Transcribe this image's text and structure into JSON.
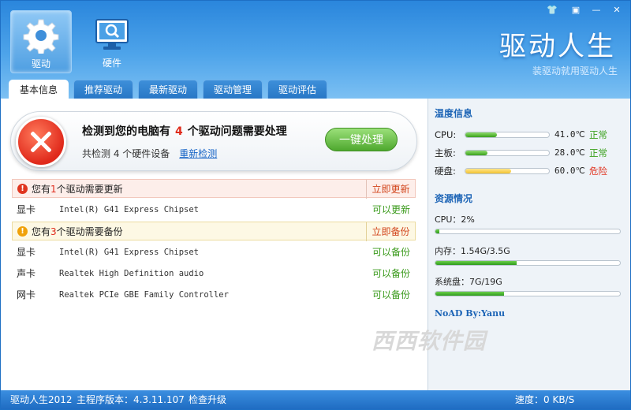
{
  "header": {
    "nav": [
      {
        "label": "驱动",
        "icon": "gear-icon"
      },
      {
        "label": "硬件",
        "icon": "monitor-search-icon"
      }
    ],
    "brand": "驱动人生",
    "slogan": "装驱动就用驱动人生",
    "window_controls": [
      "skin-icon",
      "menu-icon",
      "minimize-icon",
      "close-icon"
    ]
  },
  "tabs": [
    {
      "label": "基本信息",
      "active": true
    },
    {
      "label": "推荐驱动",
      "active": false
    },
    {
      "label": "最新驱动",
      "active": false
    },
    {
      "label": "驱动管理",
      "active": false
    },
    {
      "label": "驱动评估",
      "active": false
    }
  ],
  "alert": {
    "title_pre": "检测到您的电脑有",
    "problem_count": "4",
    "title_post": "个驱动问题需要处理",
    "summary": "共检测 4 个硬件设备",
    "rescan": "重新检测",
    "fix_button": "一键处理"
  },
  "sections": {
    "update": {
      "pre": "您有",
      "count": "1",
      "post": "个驱动需要更新",
      "action": "立即更新",
      "icon_glyph": "!"
    },
    "backup": {
      "pre": "您有",
      "count": "3",
      "post": "个驱动需要备份",
      "action": "立即备份",
      "icon_glyph": "!"
    }
  },
  "update_rows": [
    {
      "category": "显卡",
      "device": "Intel(R) G41 Express Chipset",
      "action": "可以更新"
    }
  ],
  "backup_rows": [
    {
      "category": "显卡",
      "device": "Intel(R) G41 Express Chipset",
      "action": "可以备份"
    },
    {
      "category": "声卡",
      "device": "Realtek High Definition audio",
      "action": "可以备份"
    },
    {
      "category": "网卡",
      "device": "Realtek PCIe GBE Family Controller",
      "action": "可以备份"
    }
  ],
  "temperature": {
    "title": "温度信息",
    "items": [
      {
        "label": "CPU:",
        "value": "41.0℃",
        "status": "正常",
        "level": 0.38,
        "color": "#3aa01c"
      },
      {
        "label": "主板:",
        "value": "28.0℃",
        "status": "正常",
        "level": 0.26,
        "color": "#3aa01c"
      },
      {
        "label": "硬盘:",
        "value": "60.0℃",
        "status": "危险",
        "level": 0.55,
        "color": "#e0301c"
      }
    ]
  },
  "resources": {
    "title": "资源情况",
    "items": [
      {
        "label": "CPU：2%",
        "level": 0.02
      },
      {
        "label": "内存：1.54G/3.5G",
        "level": 0.44
      },
      {
        "label": "系统盘：7G/19G",
        "level": 0.37
      }
    ]
  },
  "signature": "NoAD By:Yanu",
  "watermark": "西西软件园",
  "status": {
    "app": "驱动人生2012",
    "version": "主程序版本：4.3.11.107",
    "check_update": "检查升级",
    "speed": "速度：0 KB/S"
  }
}
